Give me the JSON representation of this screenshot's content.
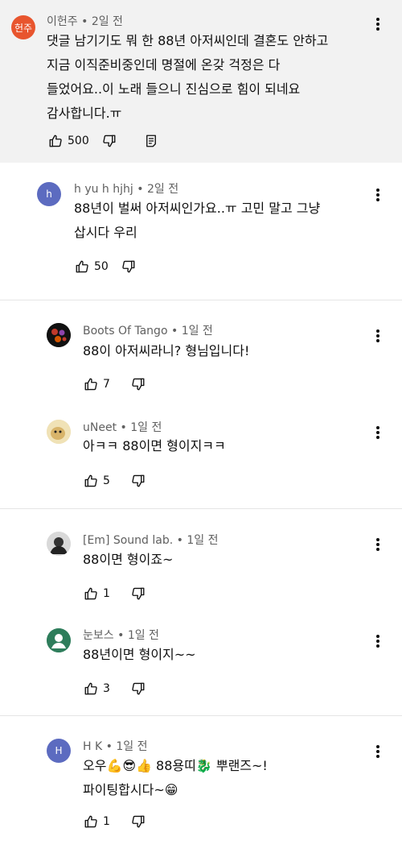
{
  "comments": [
    {
      "author": "이헌주",
      "time": "2일 전",
      "avatar_text": "헌주",
      "lines": [
        "댓글 남기기도 뭐 한 88년 아저씨인데 결혼도 안하고",
        "지금 이직준비중인데 명절에 온갖 걱정은 다",
        "들었어요..이 노래 들으니 진심으로 힘이 되네요",
        "감사합니다.ㅠ"
      ],
      "likes": "500"
    },
    {
      "author": "h yu h hjhj",
      "time": "2일 전",
      "avatar_text": "h",
      "lines": [
        "88년이 벌써 아저씨인가요..ㅠ 고민 말고 그냥",
        "삽시다 우리"
      ],
      "likes": "50"
    },
    {
      "author": "Boots Of Tango",
      "time": "1일 전",
      "lines": [
        "88이 아저씨라니? 형님입니다!"
      ],
      "likes": "7"
    },
    {
      "author": "uNeet",
      "time": "1일 전",
      "lines": [
        "아ㅋㅋ 88이면 형이지ㅋㅋ"
      ],
      "likes": "5"
    },
    {
      "author": "[Em] Sound lab.",
      "time": "1일 전",
      "lines": [
        "88이면 형이죠~"
      ],
      "likes": "1"
    },
    {
      "author": "눈보스",
      "time": "1일 전",
      "lines": [
        "88년이면 형이지~~"
      ],
      "likes": "3"
    },
    {
      "author": "H K",
      "time": "1일 전",
      "avatar_text": "H",
      "lines": [
        "오우💪😎👍 88용띠🐉 뿌랜즈~!",
        "파이팅합시다~😁"
      ],
      "likes": "1"
    }
  ],
  "colors": {
    "pinned_bg": "#f2f2f2",
    "avatar_orange": "#e8552e",
    "avatar_purple": "#5c6bc0",
    "avatar_blue": "#5c6bc0"
  }
}
